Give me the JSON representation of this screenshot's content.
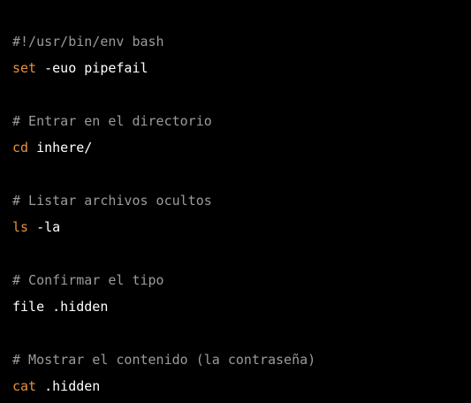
{
  "colors": {
    "background": "#000000",
    "comment": "#9b9b9b",
    "keyword": "#e8903c",
    "text": "#ffffff"
  },
  "code": {
    "shebang": "#!/usr/bin/env bash",
    "line2_keyword": "set",
    "line2_rest": " -euo pipefail",
    "comment1": "# Entrar en el directorio",
    "line5_keyword": "cd",
    "line5_rest": " inhere/",
    "comment2": "# Listar archivos ocultos",
    "line8_keyword": "ls",
    "line8_rest": " -la",
    "comment3": "# Confirmar el tipo",
    "line11": "file .hidden",
    "comment4": "# Mostrar el contenido (la contraseña)",
    "line14_keyword": "cat",
    "line14_rest": " .hidden"
  }
}
